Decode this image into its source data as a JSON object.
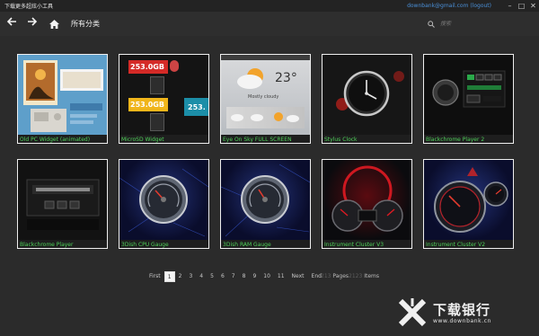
{
  "window": {
    "title": "下载更多超炫小工具",
    "user_email": "downbank@gmail.com",
    "logout_label": "(logout)",
    "controls": [
      "minimize",
      "maximize",
      "close"
    ]
  },
  "toolbar": {
    "back_icon": "back-arrow-icon",
    "forward_icon": "forward-arrow-icon",
    "home_icon": "home-icon",
    "category_label": "所有分类",
    "search_placeholder": "搜索"
  },
  "widgets": [
    {
      "label": "Old PC Widget (animated)",
      "thumb": "photo"
    },
    {
      "label": "MicroSD Widget",
      "thumb": "sd",
      "texts": [
        "253.0GB",
        "253.0GB",
        "253."
      ]
    },
    {
      "label": "Eye On Sky FULL SCREEN",
      "thumb": "sky",
      "texts": [
        "23°",
        "Mostly cloudy"
      ]
    },
    {
      "label": "Stylus Clock",
      "thumb": "clock"
    },
    {
      "label": "Blackchrome Player 2",
      "thumb": "player"
    },
    {
      "label": "Blackchrome Player",
      "thumb": "player-flat"
    },
    {
      "label": "3Dish CPU Gauge",
      "thumb": "gauge-blue"
    },
    {
      "label": "3Dish RAM Gauge",
      "thumb": "gauge-blue"
    },
    {
      "label": "Instrument Cluster V3",
      "thumb": "cluster-red"
    },
    {
      "label": "Instrument Cluster V2",
      "thumb": "cluster-blue"
    }
  ],
  "pagination": {
    "first_label": "First",
    "pages": [
      "1",
      "2",
      "3",
      "4",
      "5",
      "6",
      "7",
      "8",
      "9",
      "10",
      "11"
    ],
    "current_page": "1",
    "next_label": "Next",
    "end_label": "End",
    "pages_count": "213",
    "pages_word": "Pages",
    "items_count": "2123",
    "items_word": "Items"
  },
  "watermark": {
    "brand": "下载银行",
    "url": "www.downbank.cn"
  },
  "colors": {
    "background": "#2b2b2b",
    "label_green": "#4fd15a",
    "link_blue": "#4a90d9"
  }
}
